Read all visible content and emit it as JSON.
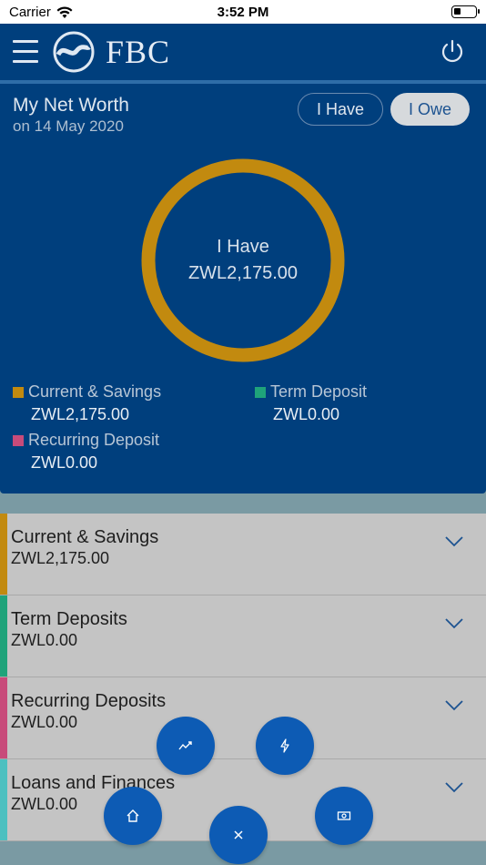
{
  "status_bar": {
    "carrier": "Carrier",
    "time": "3:52 PM"
  },
  "header": {
    "brand": "FBC"
  },
  "net_worth": {
    "title": "My Net Worth",
    "date": "on 14 May 2020",
    "toggle_have": "I Have",
    "toggle_owe": "I Owe",
    "donut_label": "I Have",
    "donut_value": "ZWL2,175.00",
    "donut_color": "#c28a0f",
    "legend": [
      {
        "label": "Current & Savings",
        "amount": "ZWL2,175.00",
        "color": "#c28a0f"
      },
      {
        "label": "Term Deposit",
        "amount": "ZWL0.00",
        "color": "#1fa37a"
      },
      {
        "label": "Recurring Deposit",
        "amount": "ZWL0.00",
        "color": "#c84b7a"
      }
    ]
  },
  "accounts": [
    {
      "name": "Current & Savings",
      "amount": "ZWL2,175.00",
      "color": "#c28a0f"
    },
    {
      "name": "Term Deposits",
      "amount": "ZWL0.00",
      "color": "#1fa37a"
    },
    {
      "name": "Recurring Deposits",
      "amount": "ZWL0.00",
      "color": "#c84b7a"
    },
    {
      "name": "Loans and Finances",
      "amount": "ZWL0.00",
      "color": "#4cc0c0"
    }
  ],
  "fab_icons": [
    "trend-icon",
    "flash-icon",
    "home-icon",
    "close-icon",
    "cash-icon"
  ]
}
